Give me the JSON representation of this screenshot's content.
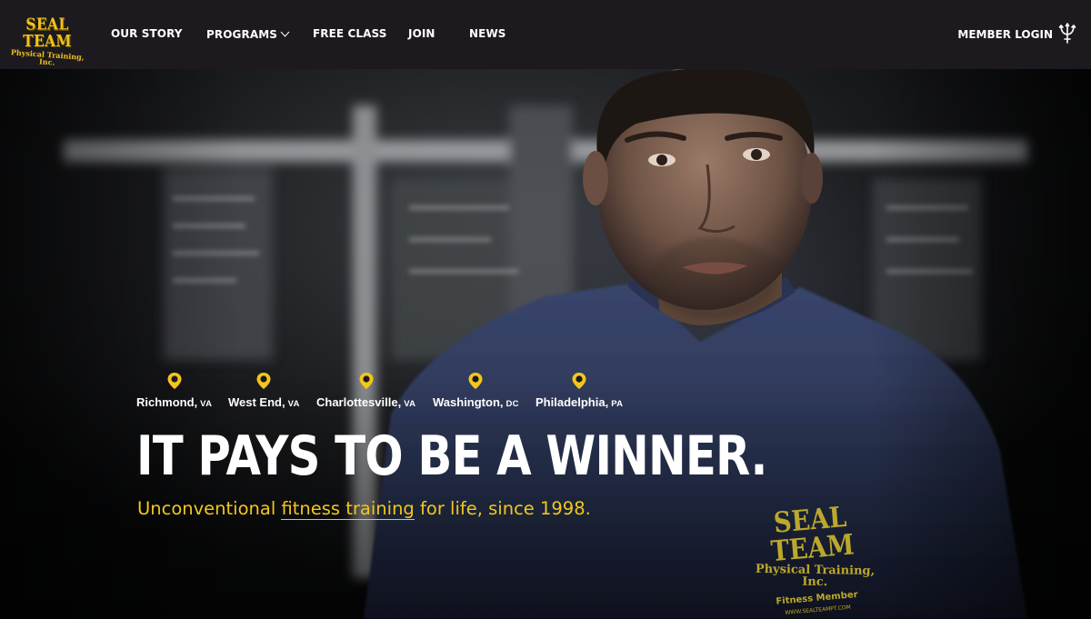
{
  "colors": {
    "nav_bg": "#1c1a1f",
    "accent": "#f3c61c",
    "text": "#ffffff"
  },
  "brand": {
    "logo_line1": "SEAL TEAM",
    "logo_line2": "Physical Training, Inc."
  },
  "nav": {
    "items": [
      {
        "label": "OUR STORY"
      },
      {
        "label": "PROGRAMS",
        "has_dropdown": true,
        "icon": "chevron-down-icon"
      },
      {
        "label": "FREE CLASS"
      },
      {
        "label": "JOIN"
      },
      {
        "label": "NEWS"
      }
    ],
    "login_label": "MEMBER LOGIN",
    "login_icon": "trident-icon"
  },
  "hero": {
    "locations": [
      {
        "city": "Richmond,",
        "state": "VA",
        "icon": "map-pin-icon"
      },
      {
        "city": "West End,",
        "state": "VA",
        "icon": "map-pin-icon"
      },
      {
        "city": "Charlottesville,",
        "state": "VA",
        "icon": "map-pin-icon"
      },
      {
        "city": "Washington,",
        "state": "DC",
        "icon": "map-pin-icon"
      },
      {
        "city": "Philadelphia,",
        "state": "PA",
        "icon": "map-pin-icon"
      }
    ],
    "headline": "IT PAYS TO BE A WINNER.",
    "tagline_before": "Unconventional ",
    "tagline_link": "fitness training",
    "tagline_after": " for life, since 1998.",
    "shirt_text": {
      "line1": "SEAL TEAM",
      "line2": "Physical Training, Inc.",
      "line3": "Fitness Member",
      "line4": "WWW.SEALTEAMPT.COM"
    }
  }
}
